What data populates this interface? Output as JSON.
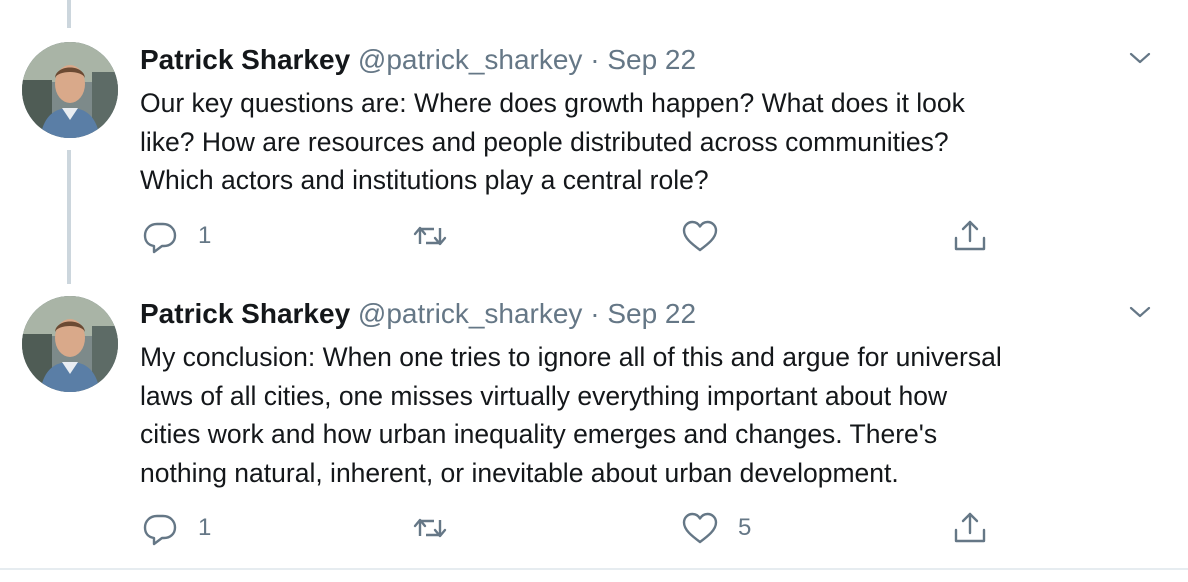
{
  "tweets": [
    {
      "author_name": "Patrick Sharkey",
      "handle": "@patrick_sharkey",
      "separator": "·",
      "date": "Sep 22",
      "lines": [
        "Our key questions are: Where does growth happen? What does it look",
        "like? How are resources and people distributed across communities?",
        "Which actors and institutions play a central role?"
      ],
      "reply_count": "1",
      "retweet_count": "",
      "like_count": ""
    },
    {
      "author_name": "Patrick Sharkey",
      "handle": "@patrick_sharkey",
      "separator": "·",
      "date": "Sep 22",
      "lines": [
        "My conclusion: When one tries to ignore all of this and argue for universal",
        "laws of all cities, one misses virtually everything important about how",
        "cities work and how urban inequality emerges and changes. There's",
        "nothing natural, inherent, or inevitable about urban development."
      ],
      "reply_count": "1",
      "retweet_count": "",
      "like_count": "5"
    }
  ],
  "icons": {
    "reply": "reply-icon",
    "retweet": "retweet-icon",
    "like": "heart-icon",
    "share": "share-icon",
    "menu": "chevron-down-icon"
  },
  "colors": {
    "text": "#14171a",
    "secondary": "#657786",
    "thread_line": "#ccd6dd",
    "divider": "#e6ecf0"
  }
}
